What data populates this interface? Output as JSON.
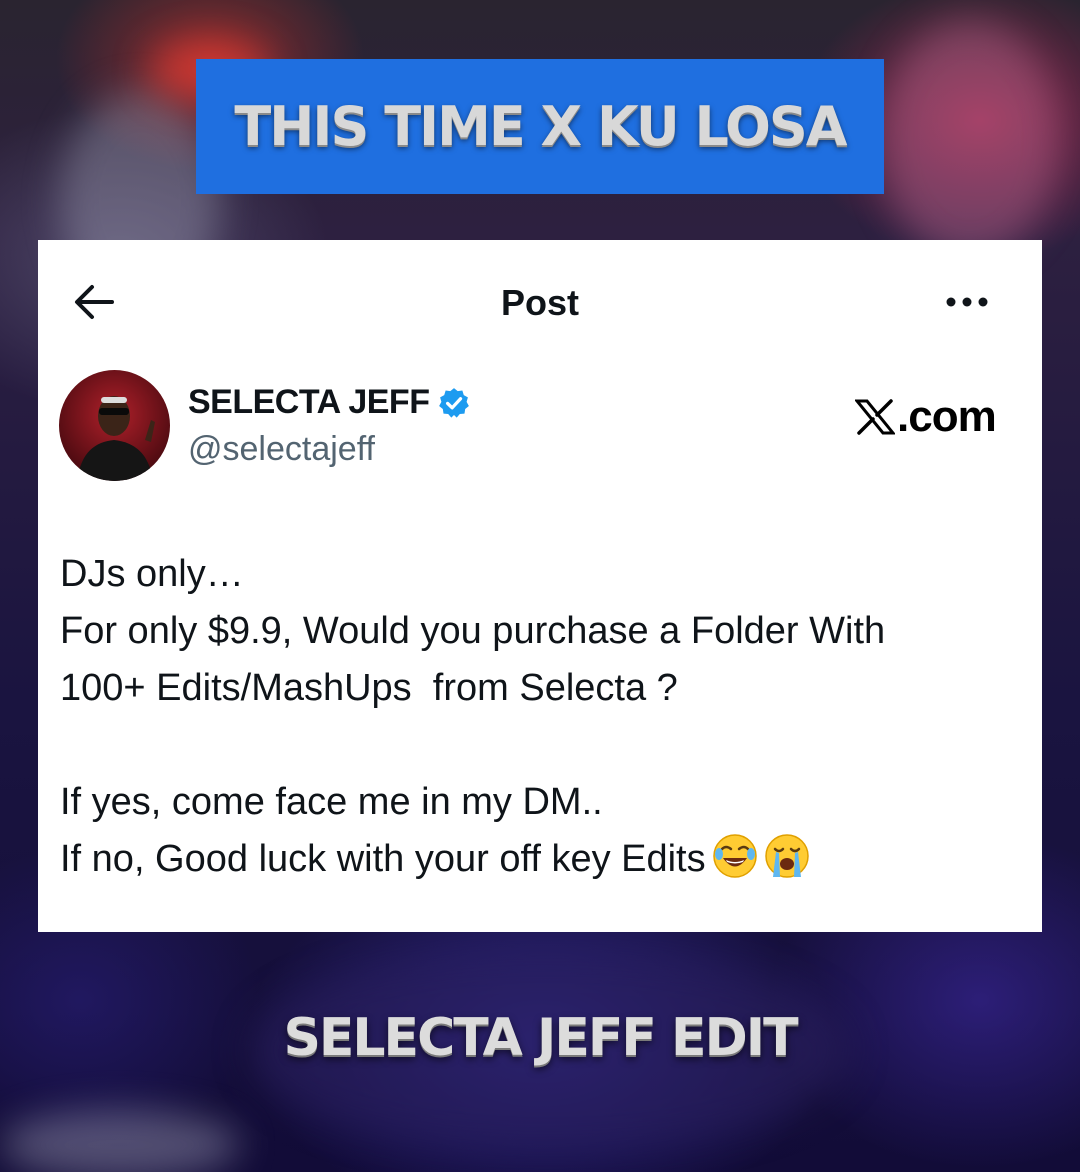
{
  "banner": {
    "text": "THIS TIME X KU LOSA"
  },
  "post": {
    "header_title": "Post",
    "back_icon": "arrow-left-icon",
    "more_icon": "more-horizontal-icon",
    "author": {
      "name": "SELECTA JEFF",
      "handle": "@selectajeff",
      "verified": true,
      "verified_color": "#1d9bf0"
    },
    "source_label": ".com",
    "source_logo": "x-logo-icon",
    "body": {
      "line1": "DJs only…",
      "line2": "For only $9.9, Would you purchase a Folder With",
      "line3": "100+ Edits/MashUps  from Selecta ?",
      "line4": "If yes, come face me in my DM..",
      "line5": "If no, Good luck with your off key Edits",
      "emojis": [
        "face-with-tears-of-joy-icon",
        "loudly-crying-face-icon"
      ]
    }
  },
  "caption": {
    "text": "SELECTA JEFF EDIT"
  },
  "colors": {
    "banner_bg": "#1f6fe0",
    "card_bg": "#ffffff",
    "text_primary": "#0f1419",
    "text_secondary": "#536471"
  }
}
